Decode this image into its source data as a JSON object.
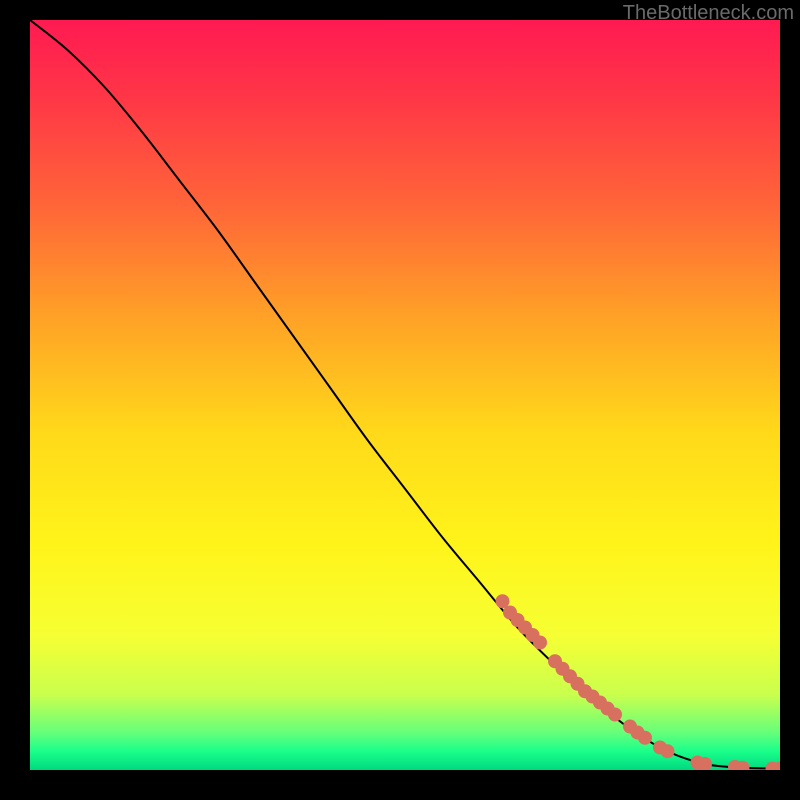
{
  "attribution": "TheBottleneck.com",
  "chart_data": {
    "type": "line",
    "title": "",
    "xlabel": "",
    "ylabel": "",
    "xlim": [
      0,
      100
    ],
    "ylim": [
      0,
      100
    ],
    "curve": [
      {
        "x": 0,
        "y": 100
      },
      {
        "x": 5,
        "y": 96
      },
      {
        "x": 10,
        "y": 91
      },
      {
        "x": 15,
        "y": 85
      },
      {
        "x": 20,
        "y": 78.5
      },
      {
        "x": 25,
        "y": 72
      },
      {
        "x": 30,
        "y": 65
      },
      {
        "x": 35,
        "y": 58
      },
      {
        "x": 40,
        "y": 51
      },
      {
        "x": 45,
        "y": 44
      },
      {
        "x": 50,
        "y": 37.5
      },
      {
        "x": 55,
        "y": 31
      },
      {
        "x": 60,
        "y": 25
      },
      {
        "x": 65,
        "y": 19
      },
      {
        "x": 70,
        "y": 14
      },
      {
        "x": 75,
        "y": 9.5
      },
      {
        "x": 80,
        "y": 5.5
      },
      {
        "x": 85,
        "y": 2.5
      },
      {
        "x": 90,
        "y": 0.8
      },
      {
        "x": 95,
        "y": 0.3
      },
      {
        "x": 100,
        "y": 0.2
      }
    ],
    "markers": [
      {
        "x": 63,
        "y": 22.5
      },
      {
        "x": 64,
        "y": 21
      },
      {
        "x": 65,
        "y": 20
      },
      {
        "x": 66,
        "y": 19
      },
      {
        "x": 67,
        "y": 18
      },
      {
        "x": 68,
        "y": 17
      },
      {
        "x": 70,
        "y": 14.5
      },
      {
        "x": 71,
        "y": 13.5
      },
      {
        "x": 72,
        "y": 12.5
      },
      {
        "x": 73,
        "y": 11.5
      },
      {
        "x": 74,
        "y": 10.5
      },
      {
        "x": 75,
        "y": 9.8
      },
      {
        "x": 76,
        "y": 9
      },
      {
        "x": 77,
        "y": 8.2
      },
      {
        "x": 78,
        "y": 7.4
      },
      {
        "x": 80,
        "y": 5.8
      },
      {
        "x": 81,
        "y": 5
      },
      {
        "x": 82,
        "y": 4.3
      },
      {
        "x": 84,
        "y": 3
      },
      {
        "x": 85,
        "y": 2.5
      },
      {
        "x": 89,
        "y": 1
      },
      {
        "x": 90,
        "y": 0.8
      },
      {
        "x": 94,
        "y": 0.4
      },
      {
        "x": 95,
        "y": 0.3
      },
      {
        "x": 99,
        "y": 0.2
      },
      {
        "x": 100,
        "y": 0.2
      }
    ],
    "gradient_stops": [
      {
        "offset": 0,
        "color": "#ff1a52"
      },
      {
        "offset": 0.1,
        "color": "#ff3547"
      },
      {
        "offset": 0.25,
        "color": "#ff6638"
      },
      {
        "offset": 0.4,
        "color": "#ffa326"
      },
      {
        "offset": 0.55,
        "color": "#ffd91a"
      },
      {
        "offset": 0.7,
        "color": "#fff41a"
      },
      {
        "offset": 0.82,
        "color": "#f6ff33"
      },
      {
        "offset": 0.9,
        "color": "#c9ff4d"
      },
      {
        "offset": 0.95,
        "color": "#66ff7a"
      },
      {
        "offset": 0.975,
        "color": "#1aff8a"
      },
      {
        "offset": 1.0,
        "color": "#00d980"
      }
    ],
    "marker_color": "#d8705f",
    "line_color": "#000000"
  }
}
